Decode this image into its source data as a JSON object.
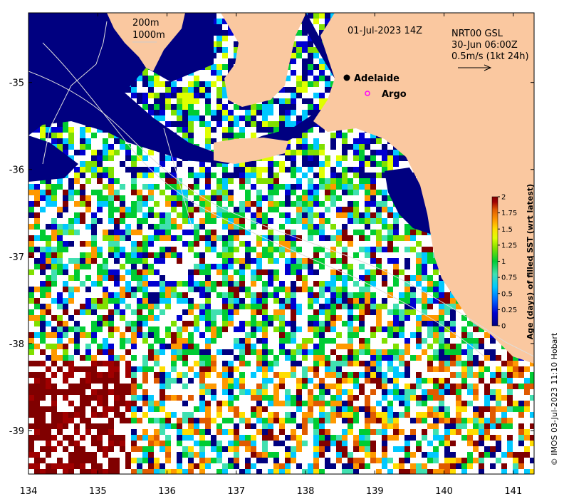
{
  "map": {
    "extent": {
      "lon": [
        134,
        141.3
      ],
      "lat": [
        -39.5,
        -34.2
      ]
    },
    "x_ticks": [
      134,
      135,
      136,
      137,
      138,
      139,
      140,
      141
    ],
    "y_ticks": [
      -35,
      -36,
      -37,
      -38,
      -39
    ],
    "x_tick_labels": [
      "134",
      "135",
      "136",
      "137",
      "138",
      "139",
      "140",
      "141"
    ],
    "y_tick_labels": [
      "-35",
      "-36",
      "-37",
      "-38",
      "-39"
    ],
    "date_label": "01-Jul-2023 14Z",
    "legend": {
      "line1": "200m",
      "line2": "1000m"
    },
    "current_info": {
      "line1": "NRT00 GSL",
      "line2": "30-Jun 06:00Z",
      "line3": "0.5m/s (1kt 24h)"
    },
    "places": [
      {
        "name": "Adelaide",
        "lon": 138.6,
        "lat": -34.93,
        "marker": "filled-circle"
      },
      {
        "name": "Argo",
        "lon": 138.9,
        "lat": -35.12,
        "marker": "open-circle"
      }
    ],
    "colors": {
      "land": "#fac8a0",
      "ocean_no_data": "#ffffff",
      "argo_marker": "#ff00ff",
      "place_marker": "#000000"
    }
  },
  "colorbar": {
    "label": "Age (days) of filled SST (wrt latest)",
    "tick_labels": [
      "0",
      "0.25",
      "0.5",
      "0.75",
      "1",
      "1.25",
      "1.5",
      "1.75",
      "2"
    ],
    "ticks": [
      0,
      0.25,
      0.5,
      0.75,
      1,
      1.25,
      1.5,
      1.75,
      2
    ],
    "range": [
      0,
      2
    ],
    "colors": [
      "#000080",
      "#0000d0",
      "#0066ff",
      "#00c8ff",
      "#40e0b0",
      "#00cc33",
      "#80e000",
      "#e0ff00",
      "#ffdd00",
      "#ff9900",
      "#e05a00",
      "#a00000",
      "#800000"
    ]
  },
  "credit": "© IMOS 03-Jul-2023 11:10 Hobart"
}
